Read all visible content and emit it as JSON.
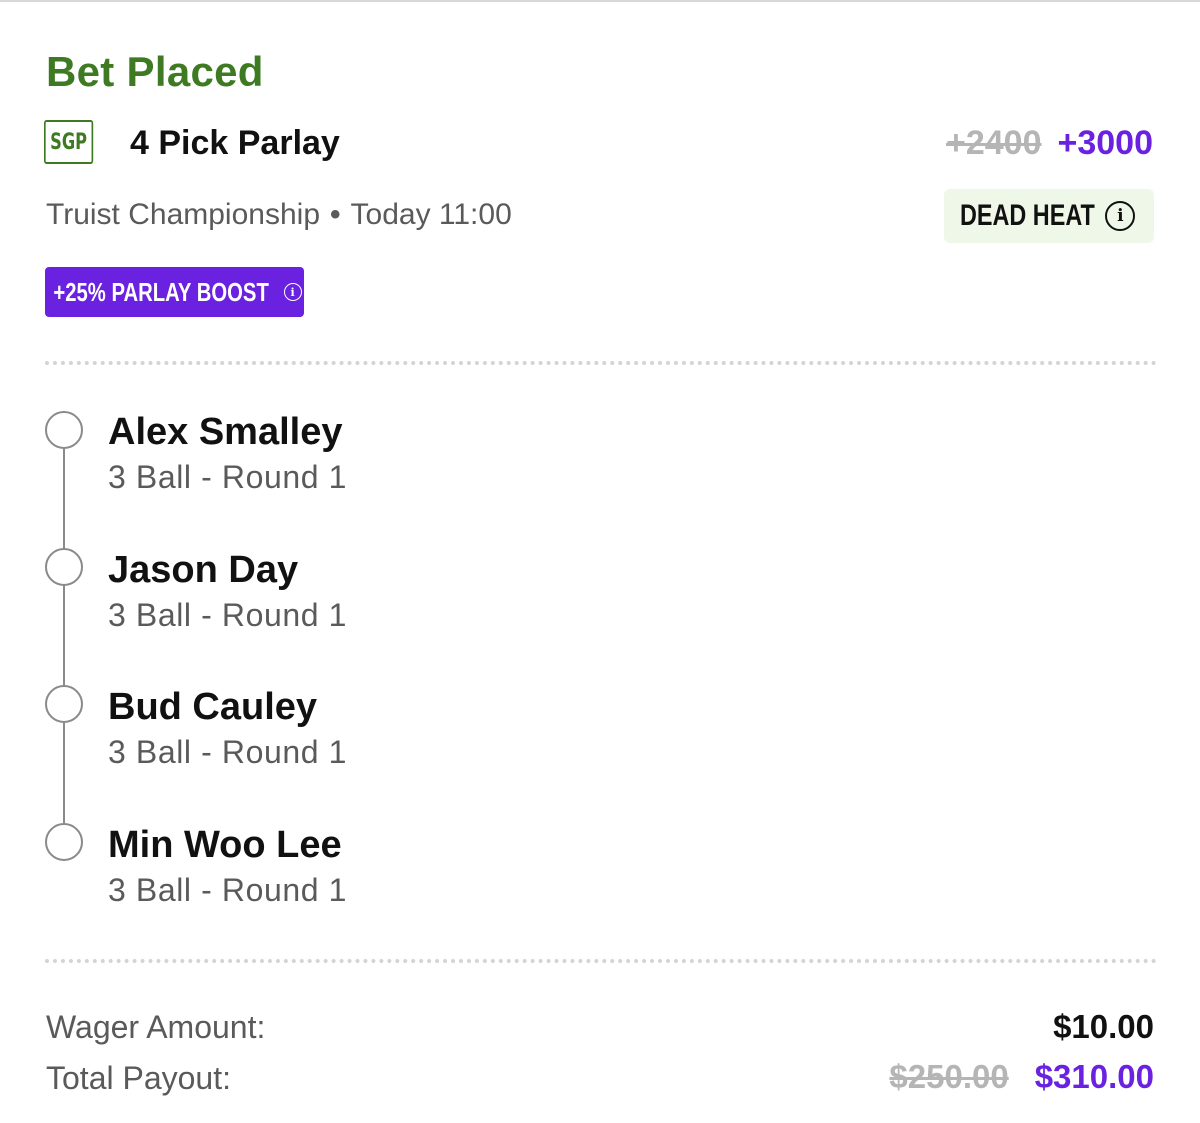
{
  "header": {
    "status_title": "Bet Placed",
    "badge": "SGP",
    "parlay_name": "4 Pick Parlay",
    "odds_original": "+2400",
    "odds_boosted": "+3000",
    "event_name": "Truist Championship",
    "separator": "•",
    "event_time": "Today 11:00",
    "dead_heat_label": "DEAD HEAT",
    "boost_label": "+25% PARLAY BOOST"
  },
  "legs": [
    {
      "name": "Alex Smalley",
      "market": "3 Ball - Round 1"
    },
    {
      "name": "Jason Day",
      "market": "3 Ball - Round 1"
    },
    {
      "name": "Bud Cauley",
      "market": "3 Ball - Round 1"
    },
    {
      "name": "Min Woo Lee",
      "market": "3 Ball - Round 1"
    }
  ],
  "summary": {
    "wager_label": "Wager Amount:",
    "wager_value": "$10.00",
    "payout_label": "Total Payout:",
    "payout_original": "$250.00",
    "payout_boosted": "$310.00"
  },
  "colors": {
    "brand_green": "#3d7a22",
    "boost_purple": "#6a22e0",
    "dead_heat_bg": "#eef7e8",
    "struck_gray": "#b5b5b5"
  },
  "icons": {
    "dead_heat_info": "info-icon",
    "boost_info": "info-icon",
    "leg_status": "open-circle-icon"
  }
}
